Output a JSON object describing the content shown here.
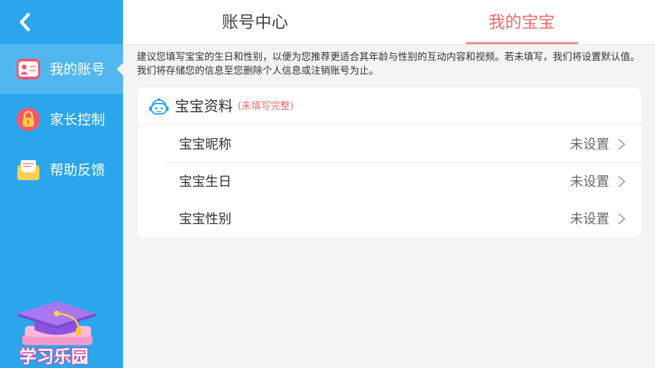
{
  "sidebar": {
    "back_icon": "chevron-left-icon",
    "items": [
      {
        "label": "我的账号",
        "icon": "id-card-icon",
        "active": true
      },
      {
        "label": "家长控制",
        "icon": "lock-icon",
        "active": false
      },
      {
        "label": "帮助反馈",
        "icon": "envelope-icon",
        "active": false
      }
    ],
    "logo_text": "学习乐园",
    "logo_icon": "graduation-cap-books-icon"
  },
  "tabs": [
    {
      "label": "账号中心",
      "active": false
    },
    {
      "label": "我的宝宝",
      "active": true
    }
  ],
  "notice": "建议您填写宝宝的生日和性别，以便为您推荐更适合其年龄与性别的互动内容和视频。若未填写，我们将设置默认值。我们将存储您的信息至您删除个人信息或注销账号为止。",
  "card": {
    "icon": "baby-face-icon",
    "title": "宝宝资料",
    "note": "(未填写完整)",
    "rows": [
      {
        "label": "宝宝昵称",
        "value": "未设置"
      },
      {
        "label": "宝宝生日",
        "value": "未设置"
      },
      {
        "label": "宝宝性别",
        "value": "未设置"
      }
    ]
  },
  "colors": {
    "sidebar": "#2aa6ec",
    "sidebar_active": "#52b7f0",
    "accent": "#f06a6a",
    "background": "#f4f4f4"
  }
}
